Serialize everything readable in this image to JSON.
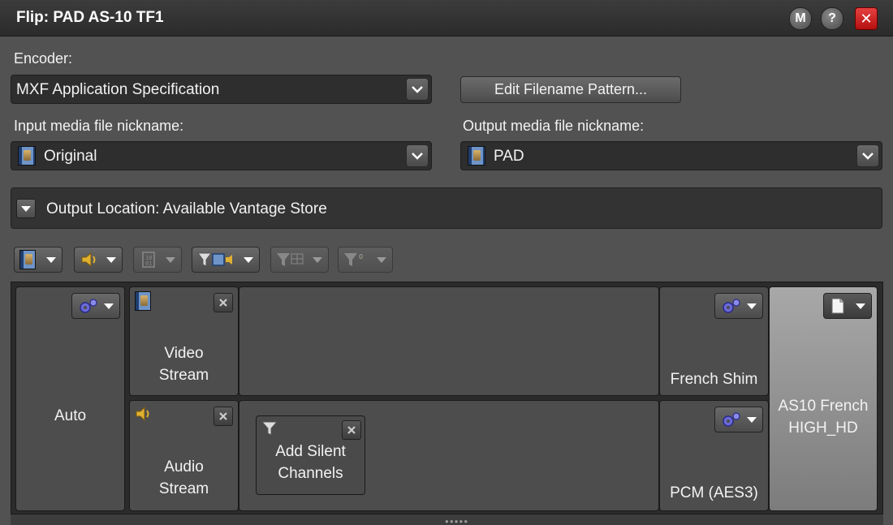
{
  "window": {
    "title": "Flip: PAD AS-10 TF1",
    "m_button": "M",
    "help_button": "?",
    "close_button": "✕"
  },
  "encoder": {
    "label": "Encoder:",
    "value": "MXF Application Specification",
    "edit_pattern_button": "Edit Filename Pattern..."
  },
  "input_nickname": {
    "label": "Input media file nickname:",
    "value": "Original"
  },
  "output_nickname": {
    "label": "Output media file nickname:",
    "value": "PAD"
  },
  "output_location": {
    "text": "Output Location: Available Vantage Store"
  },
  "toolbar": {
    "items": [
      {
        "icon": "video-track-icon",
        "enabled": true
      },
      {
        "icon": "audio-track-icon",
        "enabled": true
      },
      {
        "icon": "data-track-icon",
        "enabled": false
      },
      {
        "icon": "video-filter-icon",
        "enabled": true
      },
      {
        "icon": "grid-filter-icon",
        "enabled": false
      },
      {
        "icon": "audio-filter-icon",
        "enabled": false
      }
    ]
  },
  "grid": {
    "auto_label": "Auto",
    "video_stream": {
      "line1": "Video",
      "line2": "Stream"
    },
    "audio_stream": {
      "line1": "Audio",
      "line2": "Stream"
    },
    "add_silent": {
      "line1": "Add Silent",
      "line2": "Channels"
    },
    "french_shim": "French Shim",
    "pcm": "PCM (AES3)",
    "container": {
      "line1": "AS10 French",
      "line2": "HIGH_HD"
    }
  },
  "colors": {
    "background": "#525252",
    "titlebar": "#2f2f2f",
    "close_red": "#d42020"
  }
}
